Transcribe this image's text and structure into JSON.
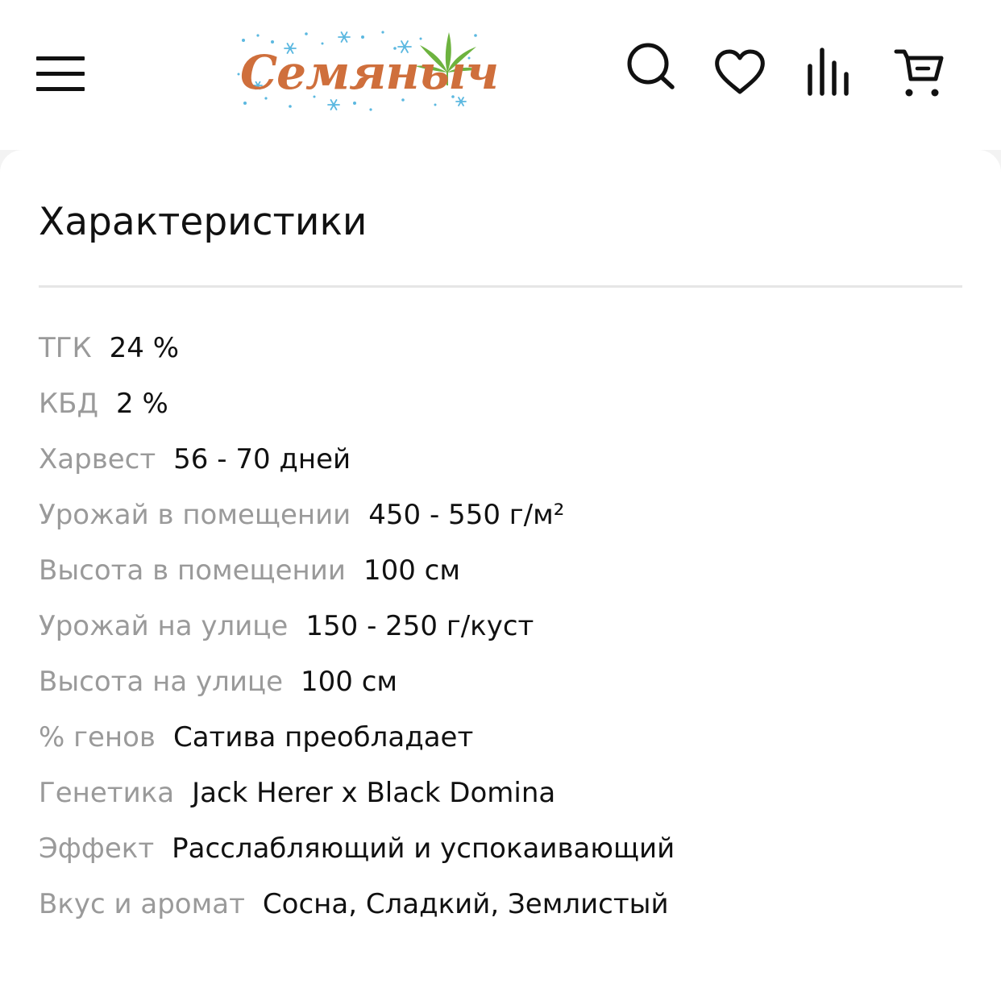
{
  "header": {
    "logo_text": "Семяныч",
    "menu_icon": "hamburger-menu-icon",
    "icons": [
      "search-icon",
      "heart-icon",
      "compare-icon",
      "cart-icon"
    ]
  },
  "colors": {
    "brand_orange": "#cf6f3c",
    "leaf_green": "#6db33f",
    "snow_blue": "#5bb8e0",
    "label_gray": "#9a9a9a",
    "text_dark": "#111111"
  },
  "characteristics": {
    "title": "Характеристики",
    "rows": [
      {
        "label": "ТГК",
        "value": "24 %"
      },
      {
        "label": "КБД",
        "value": "2 %"
      },
      {
        "label": "Харвест",
        "value": "56 - 70 дней"
      },
      {
        "label": "Урожай в помещении",
        "value": "450 - 550 г/м²"
      },
      {
        "label": "Высота в помещении",
        "value": "100 см"
      },
      {
        "label": "Урожай на улице",
        "value": "150 - 250 г/куст"
      },
      {
        "label": "Высота на улице",
        "value": "100 см"
      },
      {
        "label": "% генов",
        "value": "Сатива преобладает"
      },
      {
        "label": "Генетика",
        "value": "Jack Herer x Black Domina"
      },
      {
        "label": "Эффект",
        "value": "Расслабляющий и успокаивающий"
      },
      {
        "label": "Вкус и аромат",
        "value": "Сосна, Сладкий, Землистый"
      }
    ]
  }
}
